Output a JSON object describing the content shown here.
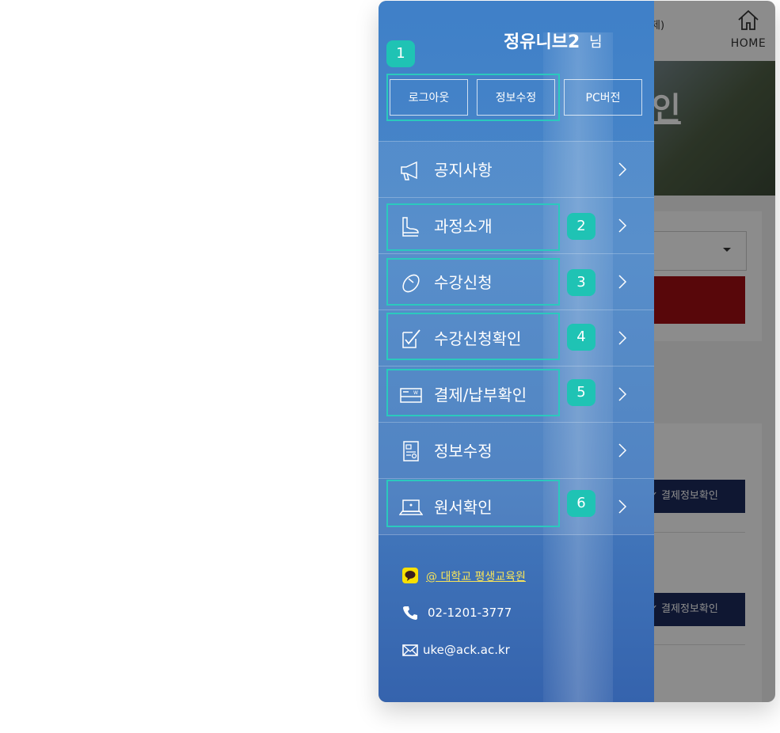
{
  "background_page": {
    "header_text": "제)",
    "home_label": "HOME",
    "banner_text": "인",
    "pay_info_buttons": [
      "결제정보확인",
      "결제정보확인"
    ]
  },
  "drawer": {
    "user_name": "정유니브2",
    "user_suffix": "님",
    "buttons": {
      "logout": "로그아웃",
      "edit_info": "정보수정",
      "pc_version": "PC버전"
    },
    "menu": [
      {
        "label": "공지사항",
        "icon": "megaphone-icon"
      },
      {
        "label": "과정소개",
        "icon": "chair-icon"
      },
      {
        "label": "수강신청",
        "icon": "mouse-icon"
      },
      {
        "label": "수강신청확인",
        "icon": "checklist-icon"
      },
      {
        "label": "결제/납부확인",
        "icon": "card-icon"
      },
      {
        "label": "정보수정",
        "icon": "document-icon"
      },
      {
        "label": "원서확인",
        "icon": "laptop-icon"
      }
    ],
    "footer": {
      "kakao": "@       대학교 평생교육원",
      "phone": "02-1201-3777",
      "email": "uke@ack.ac.kr"
    }
  },
  "annotations": {
    "badges": [
      "1",
      "2",
      "3",
      "4",
      "5",
      "6"
    ]
  },
  "colors": {
    "highlight": "#2bc9bd",
    "badge": "#1fc3b4",
    "drawer_top": "#3f80c8",
    "drawer_bottom": "#3563ad",
    "pay_button": "#1c2a5c",
    "red_bar": "#a10e13"
  }
}
